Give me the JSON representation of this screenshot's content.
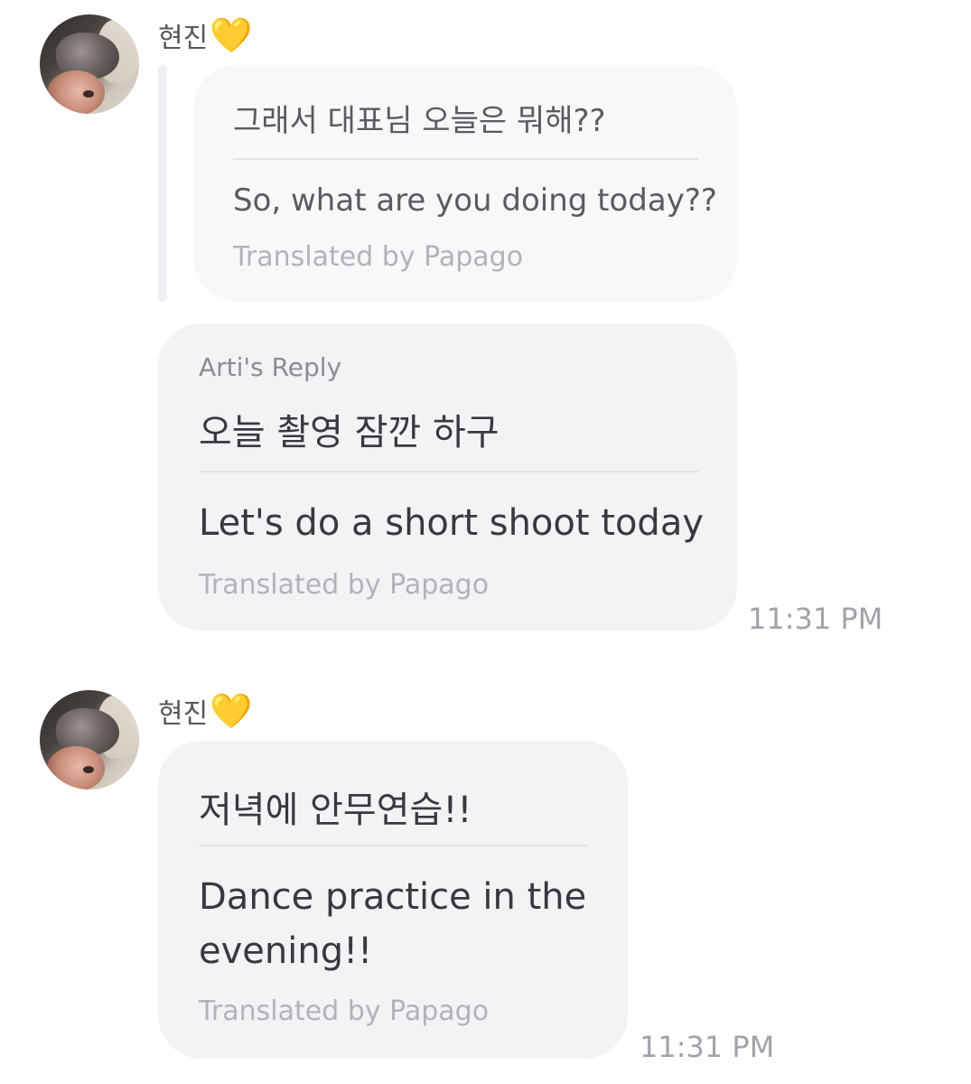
{
  "messages": {
    "first": {
      "sender_name": "현진",
      "heart": "💛",
      "quoted": {
        "original": "그래서 대표님 오늘은 뭐해??",
        "translation": "So, what are you doing today??",
        "translated_by": "Translated by Papago"
      },
      "reply_label": "Arti's Reply",
      "reply": {
        "original": "오늘 촬영 잠깐 하구",
        "translation": "Let's do a short shoot today",
        "translated_by": "Translated by Papago"
      },
      "time": "11:31 PM"
    },
    "second": {
      "sender_name": "현진",
      "heart": "💛",
      "original": "저녁에 안무연습!!",
      "translation_line1": "Dance practice in the",
      "translation_line2": "evening!!",
      "translated_by": "Translated by Papago",
      "time": "11:31 PM"
    }
  },
  "colors": {
    "bubble": "#f3f3f6",
    "quoted_bubble": "#f8f8fa",
    "heart": "#f7c534",
    "muted_text": "#b2b2ba"
  }
}
